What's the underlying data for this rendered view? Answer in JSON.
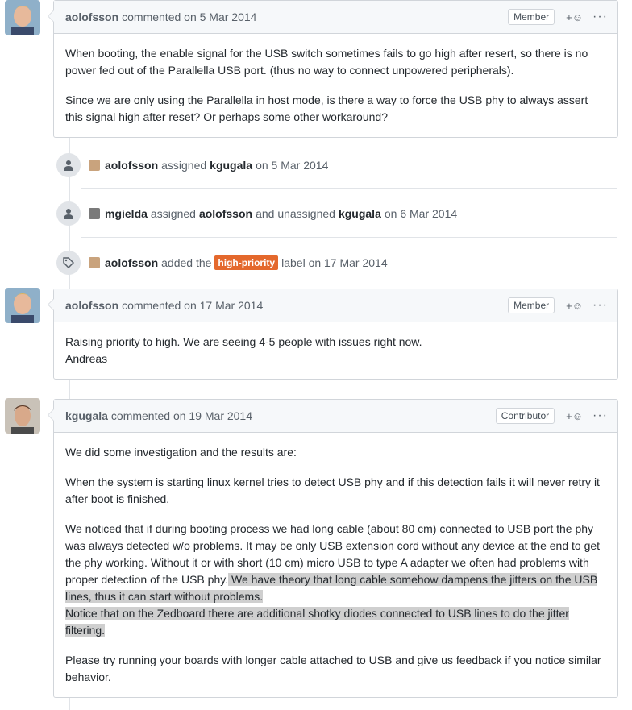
{
  "comments": [
    {
      "author": "aolofsson",
      "meta": "commented on 5 Mar 2014",
      "role": "Member",
      "paragraphs": [
        "When booting, the enable signal for the USB switch sometimes fails to go high after resert, so there is no power fed out of the Parallella USB port. (thus no way to connect unpowered peripherals).",
        "Since we are only using the Parallella in host mode, is there a way to force the USB phy to always assert this signal high after reset? Or perhaps some other workaround?"
      ]
    },
    {
      "author": "aolofsson",
      "meta": "commented on 17 Mar 2014",
      "role": "Member",
      "line1": "Raising priority to high. We are seeing 4-5 people with issues right now.",
      "line2": "Andreas"
    },
    {
      "author": "kgugala",
      "meta": "commented on 19 Mar 2014",
      "role": "Contributor",
      "p1": "We did some investigation and the results are:",
      "p2": "When the system is starting linux kernel tries to detect USB phy and if this detection fails it will never retry it after boot is finished.",
      "p3a": "We noticed that if during booting process we had long cable (about 80 cm) connected to USB port the phy was always detected w/o problems. It may be only USB extension cord without any device at the end to get the phy working. Without it or with short (10 cm) micro USB to type A adapter we often had problems with proper detection of the USB phy.",
      "p3b": " We have theory that long cable somehow dampens the jitters on the USB lines, thus it can start without problems.",
      "p3c": "Notice that on the Zedboard there are additional shotky diodes connected to USB lines to do the jitter filtering.",
      "p4": "Please try running your boards with longer cable attached to USB and give us feedback if you notice similar behavior."
    }
  ],
  "events": [
    {
      "icon": "person-icon",
      "actor": "aolofsson",
      "text1": "assigned",
      "target": "kgugala",
      "text2": "on 5 Mar 2014"
    },
    {
      "icon": "person-icon",
      "actor": "mgielda",
      "text1": "assigned",
      "target": "aolofsson",
      "text2": "and unassigned",
      "target2": "kgugala",
      "text3": "on 6 Mar 2014"
    },
    {
      "icon": "tag-icon",
      "actor": "aolofsson",
      "text1": "added the",
      "label": "high-priority",
      "text2": "label on 17 Mar 2014"
    }
  ],
  "reaction_glyph": "+☺",
  "more_glyph": "···",
  "colors": {
    "label_high_priority": "#e4682c",
    "highlight": "#cfcfcf"
  }
}
